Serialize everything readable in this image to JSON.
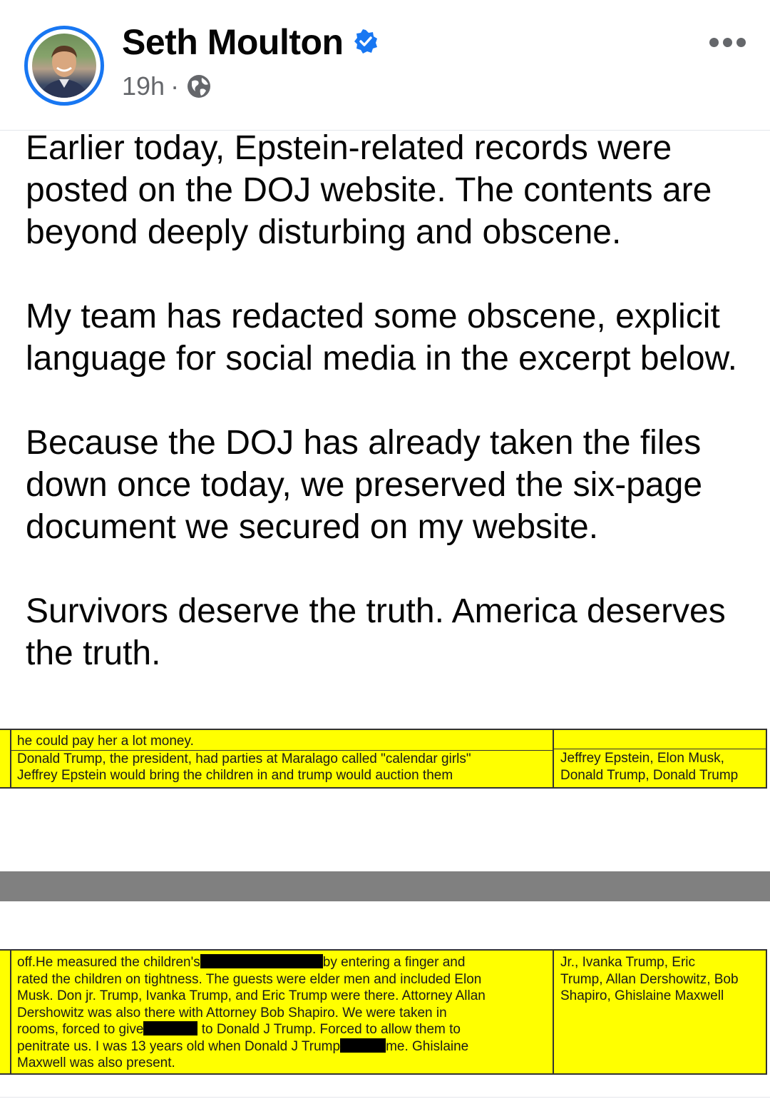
{
  "post": {
    "author": "Seth Moulton",
    "time": "19h",
    "separator": "·",
    "audience_icon": "globe-icon",
    "verified_icon": "verified-badge-icon",
    "more_icon": "more-options-icon",
    "paragraphs": [
      "Earlier today, Epstein-related records were posted on the DOJ website. The contents are beyond deeply disturbing and obscene.",
      "My team has redacted some obscene, explicit language for social media in the excerpt below.",
      "Because the DOJ has already taken the files down once today, we preserved the six-page document we secured on my website.",
      "Survivors deserve the truth. America deserves the truth."
    ]
  },
  "excerpt_top": {
    "line1": "he could pay her a lot money.",
    "line2": "Donald Trump, the president, had parties at Maralago called \"calendar girls\"",
    "line3": "Jeffrey Epstein would bring the children in and trump would auction them",
    "names1": "Jeffrey Epstein, Elon Musk,",
    "names2": "Donald Trump, Donald Trump"
  },
  "excerpt_bottom": {
    "l1a": "off.He measured the children's",
    "l1b": "by entering a finger and",
    "l2": "rated the children on tightness. The guests were elder men and included Elon",
    "l3": "Musk. Don jr. Trump, Ivanka Trump, and Eric Trump were there. Attorney Allan",
    "l4": "Dershowitz was also there with Attorney Bob Shapiro. We were taken in",
    "l5a": "rooms, forced to give",
    "l5b": "to Donald J Trump. Forced to allow them to",
    "l6a": "penitrate us. I was 13 years old when Donald J Trump",
    "l6b": "me. Ghislaine",
    "l7": "Maxwell was also present.",
    "names1": "Jr., Ivanka Trump, Eric",
    "names2": "Trump, Allan Dershowitz, Bob",
    "names3": "Shapiro, Ghislaine Maxwell"
  },
  "colors": {
    "highlight": "#ffff00",
    "accent": "#1877f2",
    "divider": "#808080"
  }
}
